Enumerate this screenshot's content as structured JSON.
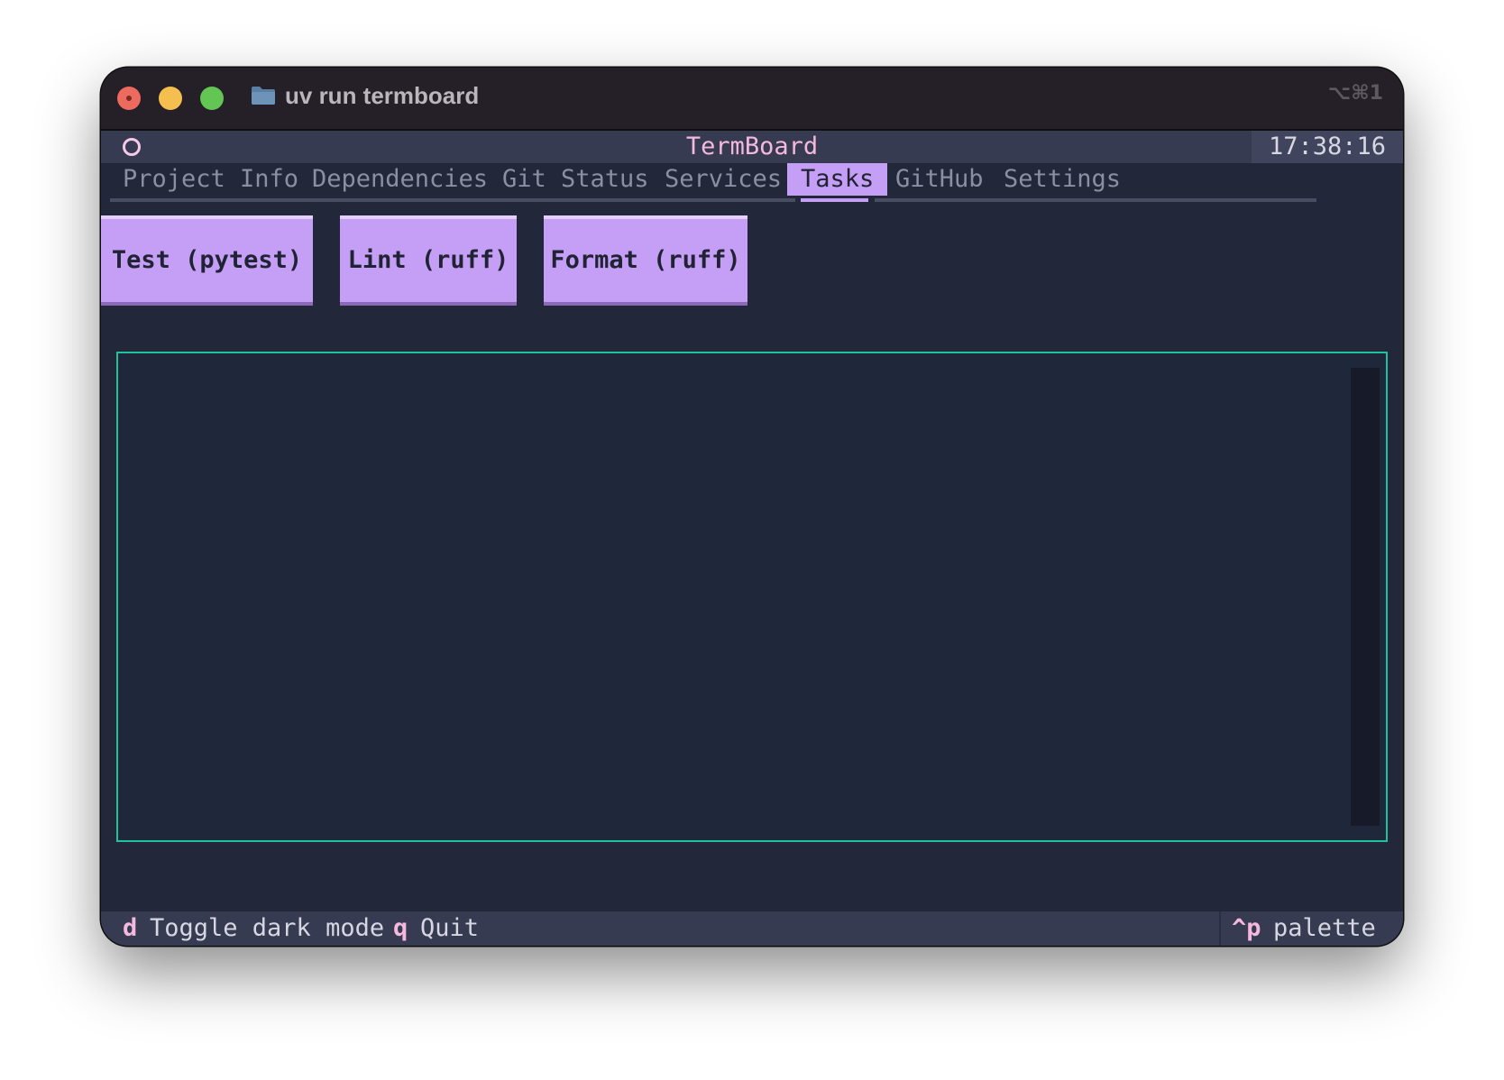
{
  "window": {
    "title": "uv run termboard",
    "shortcut": "⌥⌘1"
  },
  "header": {
    "title": "TermBoard",
    "clock": "17:38:16"
  },
  "tabs": [
    {
      "label": "Project Info",
      "active": false
    },
    {
      "label": "Dependencies",
      "active": false
    },
    {
      "label": "Git Status",
      "active": false
    },
    {
      "label": "Services",
      "active": false
    },
    {
      "label": "Tasks",
      "active": true
    },
    {
      "label": "GitHub",
      "active": false
    },
    {
      "label": "Settings",
      "active": false
    }
  ],
  "task_buttons": [
    {
      "label": "Test (pytest)"
    },
    {
      "label": "Lint (ruff)"
    },
    {
      "label": "Format (ruff)"
    }
  ],
  "log_output": "",
  "footer": {
    "bindings": [
      {
        "key": "d",
        "description": "Toggle dark mode"
      },
      {
        "key": "q",
        "description": "Quit"
      }
    ],
    "palette": {
      "key": "^p",
      "description": "palette"
    }
  },
  "colors": {
    "accent": "#c59ef5",
    "title_pink": "#f5b8de",
    "panel_border": "#1fc39a",
    "background": "#222739"
  }
}
